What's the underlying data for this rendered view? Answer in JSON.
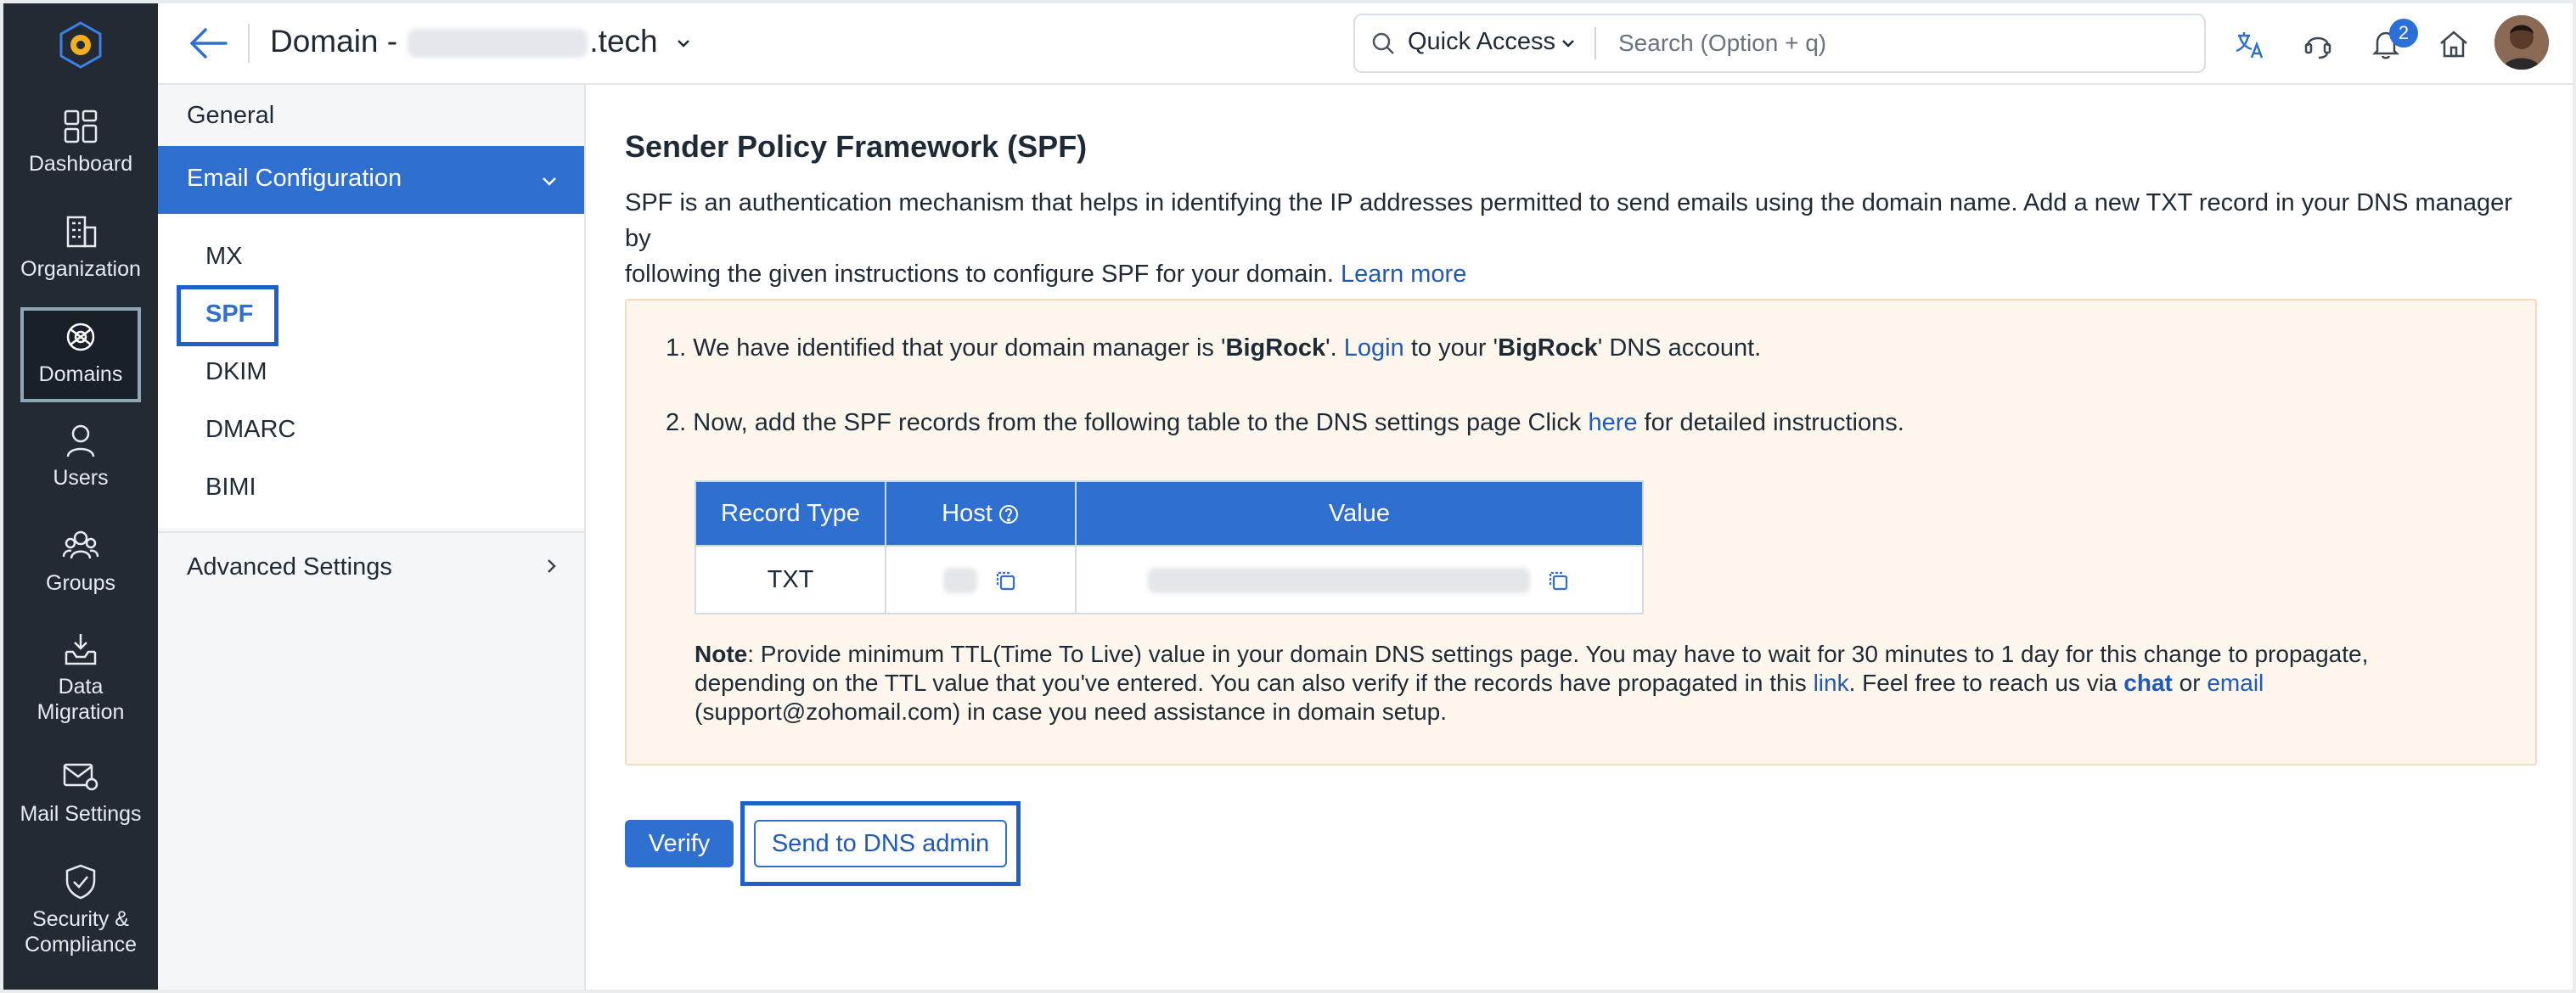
{
  "header": {
    "title_prefix": "Domain -",
    "title_suffix": ".tech",
    "quick_access_label": "Quick Access",
    "search_placeholder": "Search (Option + q)",
    "notification_count": "2"
  },
  "rail": {
    "items": [
      {
        "label": "Dashboard",
        "icon": "dashboard-icon"
      },
      {
        "label": "Organization",
        "icon": "organization-icon"
      },
      {
        "label": "Domains",
        "icon": "domains-icon",
        "active": true
      },
      {
        "label": "Users",
        "icon": "user-icon"
      },
      {
        "label": "Groups",
        "icon": "groups-icon"
      },
      {
        "label": "Data",
        "label2": "Migration",
        "icon": "data-migration-icon"
      },
      {
        "label": "Mail Settings",
        "icon": "mail-settings-icon"
      },
      {
        "label": "Security &",
        "label2": "Compliance",
        "icon": "security-icon"
      }
    ]
  },
  "subnav": {
    "general": "General",
    "email_config": "Email Configuration",
    "items": [
      "MX",
      "SPF",
      "DKIM",
      "DMARC",
      "BIMI"
    ],
    "advanced": "Advanced Settings"
  },
  "main": {
    "title": "Sender Policy Framework (SPF)",
    "desc_line1": "SPF is an authentication mechanism that helps in identifying the IP addresses permitted to send emails using the domain name. Add a new TXT record in your DNS manager by",
    "desc_line2": "following the given instructions to configure SPF for your domain.",
    "learn_more": "Learn more",
    "step1": {
      "num": "1.",
      "a": "We have identified that your domain manager is '",
      "b": "BigRock",
      "c": "'.",
      "login": "Login",
      "d": "to your '",
      "e": "BigRock",
      "f": "' DNS account."
    },
    "step2": {
      "num": "2.",
      "a": "Now, add the SPF records from the following table to the DNS settings page Click",
      "here": "here",
      "b": "for detailed instructions."
    },
    "table": {
      "headers": [
        "Record Type",
        "Host",
        "Value"
      ],
      "row": {
        "record_type": "TXT"
      }
    },
    "note": {
      "label": "Note",
      "text1": ": Provide minimum TTL(Time To Live) value in your domain DNS settings page. You may have to wait for 30 minutes to 1 day for this change to propagate,",
      "text2": "depending on the TTL value that you've entered. You can also verify if the records have propagated in this",
      "link": "link",
      "text3": ". Feel free to reach us via",
      "chat": "chat",
      "or": "or",
      "email": "email",
      "text4": "(support@zohomail.com) in case you need assistance in domain setup."
    },
    "verify_label": "Verify",
    "send_dns_label": "Send to DNS admin"
  }
}
